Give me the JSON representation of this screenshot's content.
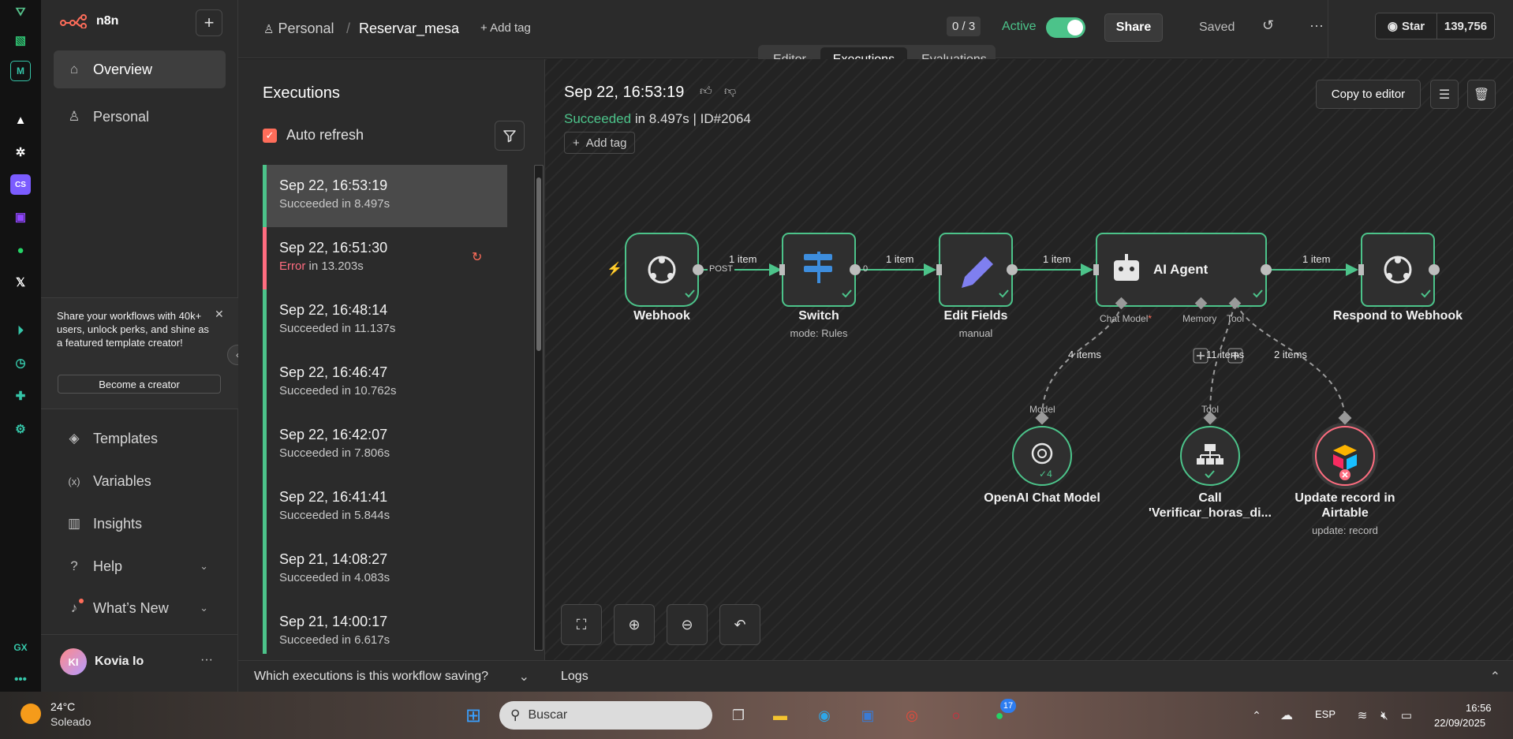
{
  "browser_strip": {
    "icons": [
      "drive-icon",
      "stripes-icon",
      "m-app-icon",
      "a-logo-icon",
      "openai-icon",
      "cs-icon",
      "twitch-icon",
      "whatsapp-icon",
      "x-icon",
      "play-icon",
      "clock-icon",
      "puzzle-icon",
      "settings-icon",
      "gx-icon",
      "more-icon"
    ],
    "gx_label": "GX"
  },
  "sidebar": {
    "logo": "n8n",
    "nav_top": [
      {
        "label": "Overview",
        "icon": "home-icon"
      },
      {
        "label": "Personal",
        "icon": "user-icon"
      }
    ],
    "promo": {
      "text": "Share your workflows with 40k+ users, unlock perks, and shine as a featured template creator!",
      "button": "Become a creator"
    },
    "nav_bottom": [
      {
        "label": "Templates",
        "icon": "templates-icon"
      },
      {
        "label": "Variables",
        "icon": "variables-icon"
      },
      {
        "label": "Insights",
        "icon": "chart-icon"
      },
      {
        "label": "Help",
        "icon": "help-icon"
      },
      {
        "label": "What’s New",
        "icon": "bell-icon"
      }
    ],
    "user": {
      "initials": "KI",
      "name": "Kovia Io"
    }
  },
  "header": {
    "crumb_project": "Personal",
    "separator": "/",
    "workflow_name": "Reservar_mesa",
    "add_tag": "+ Add tag",
    "counter": "0 / 3",
    "active_label": "Active",
    "share": "Share",
    "saved": "Saved",
    "github_star": "Star",
    "github_count": "139,756"
  },
  "tabs": [
    "Editor",
    "Executions",
    "Evaluations"
  ],
  "executions": {
    "title": "Executions",
    "auto_refresh": "Auto refresh",
    "items": [
      {
        "time": "Sep 22, 16:53:19",
        "status": "Succeeded",
        "duration": "in 8.497s"
      },
      {
        "time": "Sep 22, 16:51:30",
        "status": "Error",
        "duration": "in 13.203s"
      },
      {
        "time": "Sep 22, 16:48:14",
        "status": "Succeeded",
        "duration": "in 11.137s"
      },
      {
        "time": "Sep 22, 16:46:47",
        "status": "Succeeded",
        "duration": "in 10.762s"
      },
      {
        "time": "Sep 22, 16:42:07",
        "status": "Succeeded",
        "duration": "in 7.806s"
      },
      {
        "time": "Sep 22, 16:41:41",
        "status": "Succeeded",
        "duration": "in 5.844s"
      },
      {
        "time": "Sep 21, 14:08:27",
        "status": "Succeeded",
        "duration": "in 4.083s"
      },
      {
        "time": "Sep 21, 14:00:17",
        "status": "Succeeded",
        "duration": "in 6.617s"
      }
    ],
    "saving_question": "Which executions is this workflow saving?"
  },
  "canvas": {
    "exec_time": "Sep 22, 16:53:19",
    "status": "Succeeded",
    "status_rest": "in 8.497s | ID#2064",
    "add_tag": "Add tag",
    "copy_to_editor": "Copy to editor",
    "nodes": {
      "webhook": {
        "label": "Webhook"
      },
      "switch": {
        "label": "Switch",
        "sub": "mode: Rules"
      },
      "edit_fields": {
        "label": "Edit Fields",
        "sub": "manual"
      },
      "ai_agent": {
        "label": "AI Agent"
      },
      "respond": {
        "label": "Respond to Webhook"
      },
      "openai": {
        "label": "OpenAI Chat Model",
        "count": "4"
      },
      "call_tool": {
        "label": "Call",
        "label2": "'Verificar_horas_di..."
      },
      "airtable": {
        "label": "Update record in",
        "label2": "Airtable",
        "sub": "update: record"
      }
    },
    "edge_labels": {
      "post": "POST",
      "e1": "1 item",
      "zero": "0",
      "e2": "1 item",
      "e3": "1 item",
      "e4": "1 item",
      "model_items": "4 items",
      "tool_items": "11 items",
      "airtable_items": "2 items"
    },
    "ports": {
      "chat_model": "Chat Model",
      "memory": "Memory",
      "tool": "Tool",
      "model": "Model",
      "tool_in": "Tool"
    },
    "logs": "Logs"
  },
  "taskbar": {
    "weather_temp": "24°C",
    "weather_desc": "Soleado",
    "search": "Buscar",
    "lang": "ESP",
    "time": "16:56",
    "date": "22/09/2025",
    "whatsapp_badge": "17"
  },
  "colors": {
    "accent": "#ff6d5a",
    "success": "#4cc38a",
    "error": "#ff6d80",
    "node_border": "#4cc38a"
  }
}
